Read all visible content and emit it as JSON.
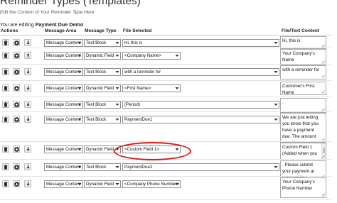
{
  "page": {
    "title": "Reminder Types (Templates)",
    "subtitle": "Edit the Content of Your Reminder Type Here",
    "editing_prefix": "You are editing",
    "editing_name": "Payment Due Demo"
  },
  "table": {
    "headers": {
      "actions": "Actions",
      "message_area": "Message Area",
      "message_type": "Message Type",
      "file_selected": "File Selected",
      "file_text_content": "File/Text Content"
    },
    "rows": [
      {
        "message_area": "Message Content",
        "message_type": "Text Block",
        "file_selected": "Hi, this is",
        "content": "Hi, this is"
      },
      {
        "message_area": "Message Content",
        "message_type": "Dynamic Field",
        "file_selected": "<Company Name>",
        "content": "Your Company's Name"
      },
      {
        "message_area": "Message Content",
        "message_type": "Text Block",
        "file_selected": "with a reminder for",
        "content": "with a reminder for"
      },
      {
        "message_area": "Message Content",
        "message_type": "Dynamic Field",
        "file_selected": "<First Name>",
        "content": "Customer's First Name"
      },
      {
        "message_area": "Message Content",
        "message_type": "Text Block",
        "file_selected": "(Period)",
        "content": "."
      },
      {
        "message_area": "Message Content",
        "message_type": "Text Block",
        "file_selected": "PaymentDue1",
        "content": "We are just letting you know that you have a payment due.  The amount owed is"
      },
      {
        "message_area": "Message Content",
        "message_type": "Dynamic Field",
        "file_selected": "<Custom Field 1>",
        "content": "Custom Field 1 (Added when you"
      },
      {
        "message_area": "Message Content",
        "message_type": "Text Block",
        "file_selected": "PaymentDue2",
        "content": ". Please submit your payment at your earliest convenience."
      },
      {
        "message_area": "Message Content",
        "message_type": "Dynamic Field",
        "file_selected": "<Company Phone Number>",
        "content": "Your Company's Phone Number"
      }
    ]
  },
  "icons": {
    "delete": "trash-icon",
    "add": "plus-circle-icon",
    "move_up": "arrow-up-icon",
    "move_down": "arrow-down-icon"
  },
  "colors": {
    "highlight": "#d81b1b"
  }
}
